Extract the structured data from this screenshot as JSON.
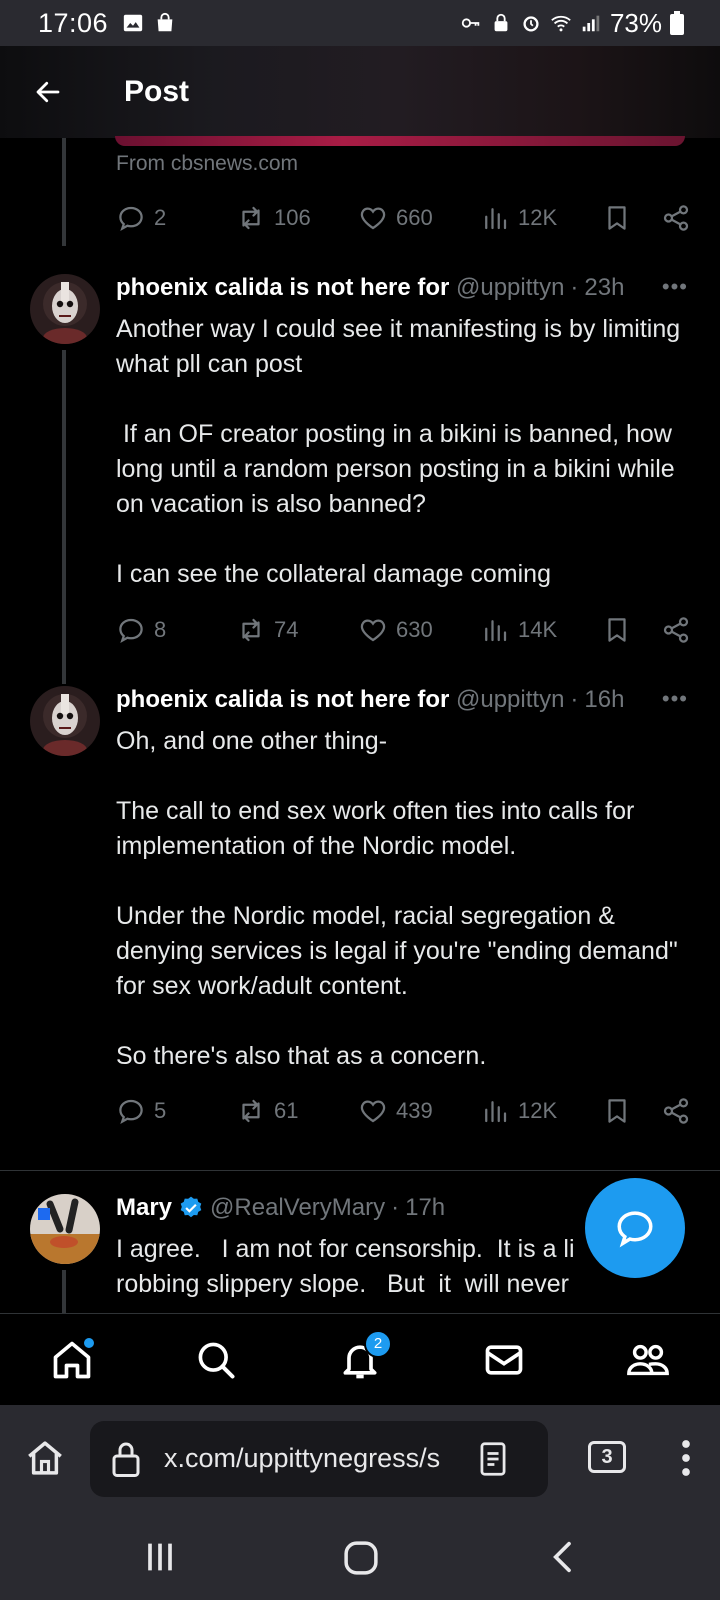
{
  "status_bar": {
    "time": "17:06",
    "battery": "73%"
  },
  "header": {
    "title": "Post"
  },
  "prev_post": {
    "source": "From cbsnews.com",
    "replies": "2",
    "reposts": "106",
    "likes": "660",
    "views": "12K"
  },
  "posts": [
    {
      "name": "phoenix calida is not here for it",
      "handle": "@uppittyn",
      "ago": "23h",
      "body": "Another way I could see it manifesting is by limiting what pll can post\n\n If an OF creator posting in a bikini is banned, how long until a random person posting in a bikini while on vacation is also banned?\n\nI can see the collateral damage coming",
      "replies": "8",
      "reposts": "74",
      "likes": "630",
      "views": "14K"
    },
    {
      "name": "phoenix calida is not here for it",
      "handle": "@uppittyn",
      "ago": "16h",
      "body": "Oh, and one other thing-\n\nThe call to end sex work often ties into calls for implementation of the Nordic model.\n\nUnder the Nordic model, racial segregation & denying services is legal if you're \"ending demand\" for sex work/adult content.\n\nSo there's also that as a concern.",
      "replies": "5",
      "reposts": "61",
      "likes": "439",
      "views": "12K"
    },
    {
      "name": "Mary",
      "handle": "@RealVeryMary",
      "ago": "17h",
      "body": "I agree.   I am not for censorship.  It is a li\nrobbing slippery slope.   But  it  will never"
    }
  ],
  "bottom_nav": {
    "notifications_badge": "2"
  },
  "browser": {
    "url": "x.com/uppittynegress/s",
    "tab_count": "3"
  },
  "colors": {
    "accent": "#1d9bf0",
    "background": "#000000",
    "muted": "#71767b"
  }
}
